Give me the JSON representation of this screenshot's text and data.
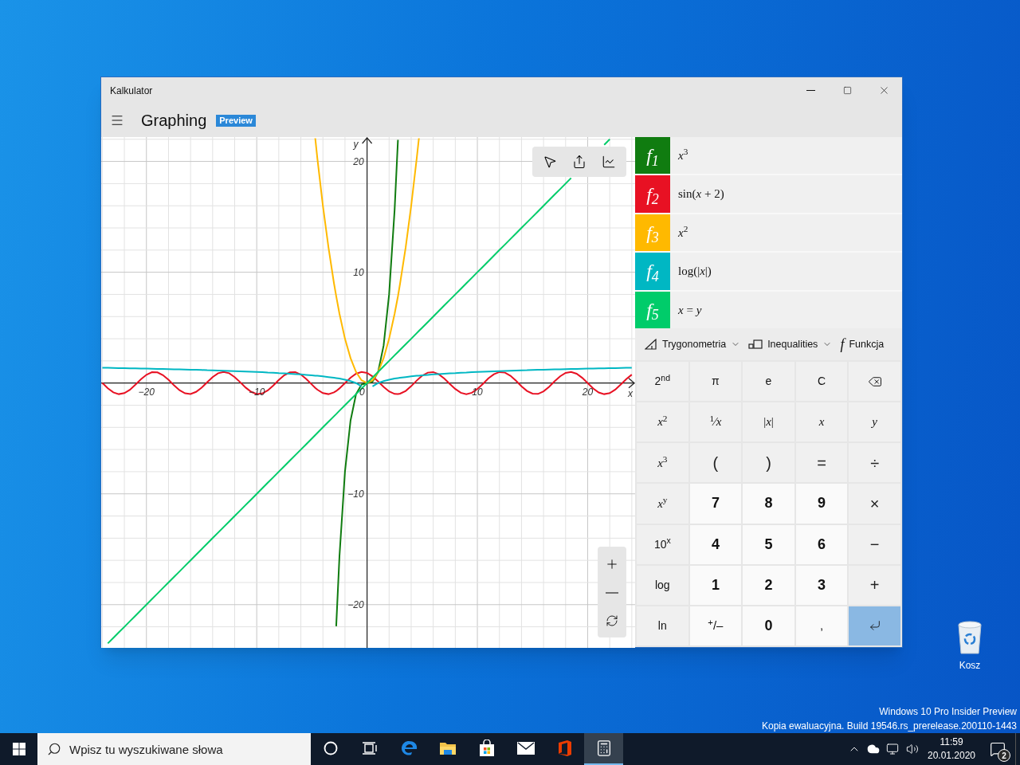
{
  "window": {
    "title": "Kalkulator",
    "mode": "Graphing",
    "badge": "Preview"
  },
  "graph": {
    "chart_data": {
      "type": "line",
      "grid": true,
      "xlabel": "x",
      "ylabel": "y",
      "xlim": [
        -24.1,
        24.3
      ],
      "ylim": [
        -23.9,
        22.2
      ],
      "xticks": [
        {
          "value": -20,
          "label": "−20"
        },
        {
          "value": -10,
          "label": "−10"
        },
        {
          "value": 0,
          "label": "0"
        },
        {
          "value": 10,
          "label": "10"
        },
        {
          "value": 20,
          "label": "20"
        }
      ],
      "yticks": [
        {
          "value": 20,
          "label": "20"
        },
        {
          "value": 10,
          "label": "10"
        },
        {
          "value": -10,
          "label": "−10"
        },
        {
          "value": -20,
          "label": "−20"
        }
      ],
      "x": [
        -24,
        -23.5,
        -23,
        -22.5,
        -22,
        -21.5,
        -21,
        -20.5,
        -20,
        -19.5,
        -19,
        -18.5,
        -18,
        -17.5,
        -17,
        -16.5,
        -16,
        -15.5,
        -15,
        -14.5,
        -14,
        -13.5,
        -13,
        -12.5,
        -12,
        -11.5,
        -11,
        -10.5,
        -10,
        -9.5,
        -9,
        -8.5,
        -8,
        -7.5,
        -7,
        -6.5,
        -6,
        -5.5,
        -5,
        -4.7,
        -4.5,
        -4,
        -3.5,
        -3,
        -2.8,
        -2.5,
        -2,
        -1.5,
        -1,
        -0.5,
        0,
        0.5,
        1,
        1.5,
        2,
        2.5,
        2.8,
        3,
        3.5,
        4,
        4.5,
        4.7,
        5,
        5.5,
        6,
        6.5,
        7,
        7.5,
        8,
        8.5,
        9,
        9.5,
        10,
        10.5,
        11,
        11.5,
        12,
        12.5,
        13,
        13.5,
        14,
        14.5,
        15,
        15.5,
        16,
        16.5,
        17,
        17.5,
        18,
        18.5,
        19,
        19.5,
        20,
        20.5,
        21,
        21.5,
        22,
        22.5,
        23,
        23.5,
        24
      ],
      "series": [
        {
          "color": "#107c10",
          "values": [
            null,
            null,
            null,
            null,
            null,
            null,
            null,
            null,
            null,
            null,
            null,
            null,
            null,
            null,
            null,
            null,
            null,
            null,
            null,
            null,
            null,
            null,
            null,
            null,
            null,
            null,
            null,
            null,
            null,
            null,
            null,
            null,
            null,
            null,
            null,
            null,
            null,
            null,
            null,
            null,
            null,
            null,
            null,
            null,
            -21.95,
            -15.63,
            -8,
            -3.38,
            -1,
            -0.13,
            0,
            0.13,
            1,
            3.38,
            8,
            15.63,
            21.95,
            null,
            null,
            null,
            null,
            null,
            null,
            null,
            null,
            null,
            null,
            null,
            null,
            null,
            null,
            null,
            null,
            null,
            null,
            null,
            null,
            null,
            null,
            null,
            null,
            null,
            null,
            null,
            null,
            null,
            null,
            null,
            null,
            null,
            null,
            null,
            null,
            null,
            null,
            null,
            null,
            null,
            null,
            null,
            null
          ]
        },
        {
          "color": "#e81123",
          "values": [
            0.01,
            -0.47,
            -0.84,
            -1,
            -0.91,
            -0.61,
            -0.15,
            0.34,
            0.75,
            0.98,
            0.96,
            0.71,
            0.29,
            -0.21,
            -0.65,
            -0.93,
            -0.99,
            -0.8,
            -0.42,
            0.07,
            0.54,
            0.88,
            1,
            0.88,
            0.54,
            0.08,
            -0.41,
            -0.8,
            -0.99,
            -0.94,
            -0.66,
            -0.22,
            0.28,
            0.71,
            0.96,
            0.98,
            0.76,
            0.35,
            -0.14,
            -0.43,
            -0.6,
            -0.91,
            -1,
            -0.84,
            -0.72,
            -0.48,
            0,
            0.48,
            0.84,
            1,
            0.91,
            0.6,
            0.14,
            -0.35,
            -0.76,
            -0.98,
            -1,
            -0.96,
            -0.71,
            -0.28,
            0.22,
            0.4,
            0.66,
            0.94,
            0.99,
            0.8,
            0.41,
            -0.08,
            -0.54,
            -0.88,
            -1,
            -0.88,
            -0.54,
            -0.07,
            0.42,
            0.8,
            0.99,
            0.94,
            0.65,
            0.21,
            -0.29,
            -0.71,
            -0.96,
            -0.98,
            -0.75,
            -0.34,
            0.15,
            0.61,
            0.91,
            1,
            0.84,
            0.47,
            -0.01,
            -0.49,
            -0.85,
            -1,
            -0.91,
            -0.59,
            -0.13,
            0.36,
            0.76
          ]
        },
        {
          "color": "#ffb900",
          "values": [
            null,
            null,
            null,
            null,
            null,
            null,
            null,
            null,
            null,
            null,
            null,
            null,
            null,
            null,
            null,
            null,
            null,
            null,
            null,
            null,
            null,
            null,
            null,
            null,
            null,
            null,
            null,
            null,
            null,
            null,
            null,
            null,
            null,
            null,
            null,
            null,
            null,
            null,
            null,
            22.09,
            20.25,
            16,
            12.25,
            9,
            7.84,
            6.25,
            4,
            2.25,
            1,
            0.25,
            0,
            0.25,
            1,
            2.25,
            4,
            6.25,
            7.84,
            9,
            12.25,
            16,
            20.25,
            22.09,
            null,
            null,
            null,
            null,
            null,
            null,
            null,
            null,
            null,
            null,
            null,
            null,
            null,
            null,
            null,
            null,
            null,
            null,
            null,
            null,
            null,
            null,
            null,
            null,
            null,
            null,
            null,
            null,
            null,
            null,
            null,
            null,
            null,
            null,
            null,
            null,
            null,
            null,
            null
          ]
        },
        {
          "color": "#00b7c3",
          "values": [
            1.38,
            1.37,
            1.36,
            1.35,
            1.34,
            1.33,
            1.32,
            1.31,
            1.3,
            1.29,
            1.28,
            1.27,
            1.26,
            1.24,
            1.23,
            1.22,
            1.2,
            1.19,
            1.18,
            1.16,
            1.15,
            1.13,
            1.11,
            1.1,
            1.08,
            1.06,
            1.04,
            1.02,
            1,
            0.98,
            0.95,
            0.93,
            0.9,
            0.88,
            0.85,
            0.81,
            0.78,
            0.74,
            0.7,
            0.67,
            0.65,
            0.6,
            0.54,
            0.48,
            0.45,
            0.4,
            0.3,
            0.18,
            0,
            -0.3,
            null,
            -0.3,
            0,
            0.18,
            0.3,
            0.4,
            0.45,
            0.48,
            0.54,
            0.6,
            0.65,
            0.67,
            0.7,
            0.74,
            0.78,
            0.81,
            0.85,
            0.88,
            0.9,
            0.93,
            0.95,
            0.98,
            1,
            1.02,
            1.04,
            1.06,
            1.08,
            1.1,
            1.11,
            1.13,
            1.15,
            1.16,
            1.18,
            1.19,
            1.2,
            1.22,
            1.23,
            1.24,
            1.26,
            1.27,
            1.28,
            1.29,
            1.3,
            1.31,
            1.32,
            1.33,
            1.34,
            1.35,
            1.36,
            1.37,
            1.38
          ]
        },
        {
          "color": "#00cc6a",
          "values": [
            null,
            -23.5,
            -23,
            -22.5,
            -22,
            -21.5,
            -21,
            -20.5,
            -20,
            -19.5,
            -19,
            -18.5,
            -18,
            -17.5,
            -17,
            -16.5,
            -16,
            -15.5,
            -15,
            -14.5,
            -14,
            -13.5,
            -13,
            -12.5,
            -12,
            -11.5,
            -11,
            -10.5,
            -10,
            -9.5,
            -9,
            -8.5,
            -8,
            -7.5,
            -7,
            -6.5,
            -6,
            -5.5,
            -5,
            -4.7,
            -4.5,
            -4,
            -3.5,
            -3,
            -2.8,
            -2.5,
            -2,
            -1.5,
            -1,
            -0.5,
            0,
            0.5,
            1,
            1.5,
            2,
            2.5,
            2.8,
            3,
            3.5,
            4,
            4.5,
            4.7,
            5,
            5.5,
            6,
            6.5,
            7,
            7.5,
            8,
            8.5,
            9,
            9.5,
            10,
            10.5,
            11,
            11.5,
            12,
            12.5,
            13,
            13.5,
            14,
            14.5,
            15,
            15.5,
            16,
            16.5,
            17,
            17.5,
            18,
            18.5,
            null,
            null,
            null,
            null,
            null,
            21.5,
            22,
            null,
            null,
            null,
            null
          ]
        }
      ]
    }
  },
  "functions": [
    {
      "label": "f$_{1}$",
      "expression": "*x*$^{3}$",
      "color": "#107c10"
    },
    {
      "label": "f$_{2}$",
      "expression": "sin(*x* + 2)",
      "color": "#e81123"
    },
    {
      "label": "f$_{3}$",
      "expression": "*x*$^{2}$",
      "color": "#ffb900"
    },
    {
      "label": "f$_{4}$",
      "expression": "log(|*x*|)",
      "color": "#00b7c3"
    },
    {
      "label": "f$_{5}$",
      "expression": "*x* = *y*",
      "color": "#00cc6a"
    }
  ],
  "toolbar": [
    {
      "label": "Trygonometria",
      "kind": "dropdown"
    },
    {
      "label": "Inequalities",
      "kind": "dropdown"
    },
    {
      "label": "Funkcja",
      "kind": "button",
      "symbol": "f"
    }
  ],
  "keypad": [
    {
      "label": "2$^{nd}$",
      "kind": "fn"
    },
    {
      "label": "π",
      "kind": "fn"
    },
    {
      "label": "e",
      "kind": "fn"
    },
    {
      "label": "C",
      "kind": "fn"
    },
    {
      "kind": "backspace"
    },
    {
      "label": "*x*$^{2}$",
      "kind": "math"
    },
    {
      "label": "$^{1}$⁄*x*",
      "kind": "math"
    },
    {
      "label": "|*x*|",
      "kind": "math"
    },
    {
      "label": "*x*",
      "kind": "math"
    },
    {
      "label": "*y*",
      "kind": "math"
    },
    {
      "label": "*x*$^{3}$",
      "kind": "math"
    },
    {
      "label": "(",
      "kind": "op"
    },
    {
      "label": ")",
      "kind": "op"
    },
    {
      "label": "=",
      "kind": "op"
    },
    {
      "label": "÷",
      "kind": "op"
    },
    {
      "label": "*x*$^{y}$",
      "kind": "math"
    },
    {
      "label": "7",
      "kind": "digit"
    },
    {
      "label": "8",
      "kind": "digit"
    },
    {
      "label": "9",
      "kind": "digit"
    },
    {
      "label": "×",
      "kind": "op"
    },
    {
      "label": "10$^{x}$",
      "kind": "fn"
    },
    {
      "label": "4",
      "kind": "digit"
    },
    {
      "label": "5",
      "kind": "digit"
    },
    {
      "label": "6",
      "kind": "digit"
    },
    {
      "label": "−",
      "kind": "op"
    },
    {
      "label": "log",
      "kind": "fn"
    },
    {
      "label": "1",
      "kind": "digit"
    },
    {
      "label": "2",
      "kind": "digit"
    },
    {
      "label": "3",
      "kind": "digit"
    },
    {
      "label": "+",
      "kind": "op"
    },
    {
      "label": "ln",
      "kind": "fn"
    },
    {
      "label": "$^{+}$/–",
      "kind": "sign"
    },
    {
      "label": "0",
      "kind": "digit"
    },
    {
      "label": ",",
      "kind": "sign"
    },
    {
      "kind": "enter"
    }
  ],
  "desktop": {
    "icons": [
      {
        "label": "Kosz"
      }
    ],
    "watermark": [
      "Windows 10 Pro Insider Preview",
      "Kopia ewaluacyjna. Build 19546.rs_prerelease.200110-1443"
    ]
  },
  "taskbar": {
    "search": {
      "placeholder": "Wpisz tu wyszukiwane słowa"
    },
    "apps": [
      {
        "kind": "cortana",
        "selected": false
      },
      {
        "kind": "taskview",
        "selected": false
      },
      {
        "kind": "edge",
        "selected": false
      },
      {
        "kind": "explorer",
        "selected": false
      },
      {
        "kind": "store",
        "selected": false
      },
      {
        "kind": "mail",
        "selected": false
      },
      {
        "kind": "office",
        "selected": false
      },
      {
        "kind": "calculator",
        "selected": true
      }
    ],
    "time": "11:59",
    "date": "20.01.2020",
    "notifications": "2"
  }
}
